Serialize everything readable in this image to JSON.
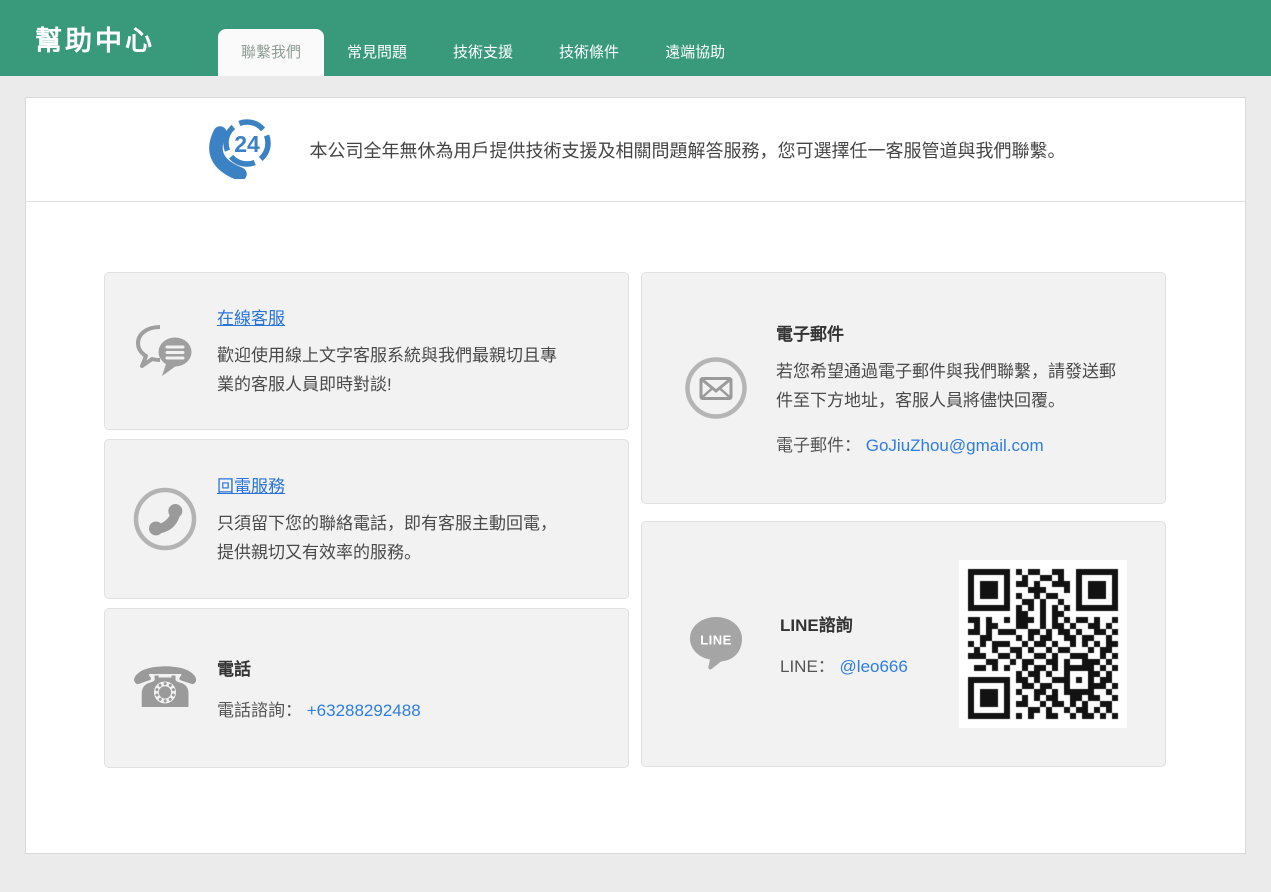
{
  "colors": {
    "header_green": "#39997b",
    "active_tab_text": "#8f9e96",
    "link_blue": "#2b74da",
    "contact_link_blue": "#2f7de2",
    "icon_gray": "#9a9a9a",
    "banner_icon_blue": "#3b82c4",
    "page_bg": "#ebebeb",
    "card_bg": "#f2f2f2"
  },
  "header": {
    "title": "幫助中心",
    "tabs": [
      {
        "label": "聯繫我們",
        "active": true
      },
      {
        "label": "常見問題",
        "active": false
      },
      {
        "label": "技術支援",
        "active": false
      },
      {
        "label": "技術條件",
        "active": false
      },
      {
        "label": "遠端協助",
        "active": false
      }
    ]
  },
  "banner": {
    "icon": "phone-24-icon",
    "badge": "24",
    "text": "本公司全年無休為用戶提供技術支援及相關問題解答服務，您可選擇任一客服管道與我們聯繫。"
  },
  "cards": {
    "online": {
      "icon": "chat-bubbles-icon",
      "title": "在線客服",
      "body": "歡迎使用線上文字客服系統與我們最親切且專業的客服人員即時對談!"
    },
    "callback": {
      "icon": "phone-circle-icon",
      "title": "回電服務",
      "body": "只須留下您的聯絡電話，即有客服主動回電，提供親切又有效率的服務。"
    },
    "phone": {
      "icon": "telephone-icon",
      "glyph": "☎",
      "title": "電話",
      "label": "電話諮詢：",
      "link": "+63288292488"
    },
    "email": {
      "icon": "envelope-circle-icon",
      "title": "電子郵件",
      "body": "若您希望通過電子郵件與我們聯繫，請發送郵件至下方地址，客服人員將儘快回覆。",
      "label": "電子郵件：",
      "link": "GoJiuZhou@gmail.com"
    },
    "line": {
      "icon": "line-logo-icon",
      "logo_text": "LINE",
      "title": "LINE諮詢",
      "label": "LINE：",
      "link": "@leo666",
      "qr": [
        "1111111010110011001111111",
        "1000001001001101001000001",
        "1011101011010011101011101",
        "1011101000111000101011101",
        "1011101010010110001011101",
        "1000001001101001001000001",
        "1111111010101010101111111",
        "0000000011001011000000000",
        "1101001011101010101101001",
        "0101100011001011010011010",
        "1101011100110101101001101",
        "0011000010101100110110010",
        "1010111001011010010101011",
        "0100100110100101100010110",
        "1110011010011010011100101",
        "0001100101100110100111010",
        "0110101001011010111110101",
        "0000000010110100100011010",
        "1111111011010011101010110",
        "1000001001101100100011101",
        "1011101010011010111110010",
        "1011101001010110011011001",
        "1011101011001011010100110",
        "1000001000110100101101010",
        "1111111010100110010110101"
      ]
    }
  }
}
